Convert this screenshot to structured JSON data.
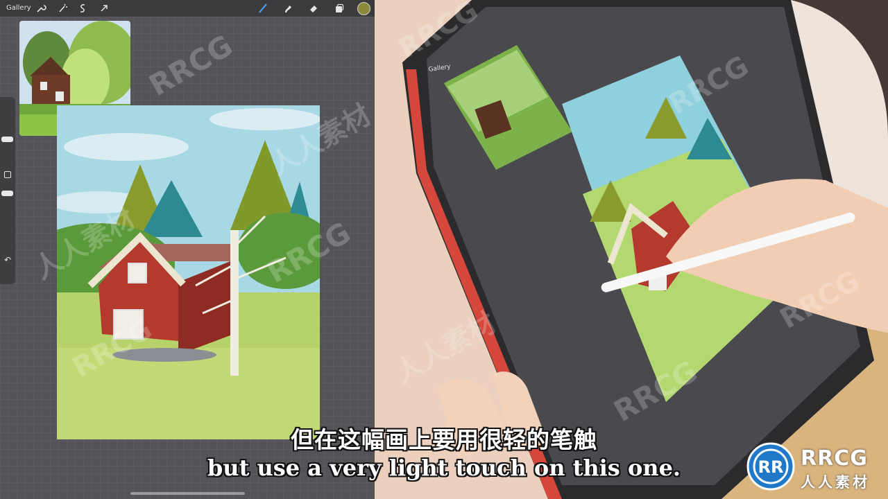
{
  "app": {
    "gallery_label": "Gallery",
    "gallery_label_small": "Gallery",
    "color_swatch": "#8c8a3a"
  },
  "toolbar": {
    "left_icons": [
      "wrench-icon",
      "magic-wand-icon",
      "selection-icon",
      "transform-arrow-icon"
    ],
    "right_icons": [
      "brush-icon",
      "smudge-icon",
      "eraser-icon",
      "layers-icon"
    ]
  },
  "sidebar": {
    "icons": [
      "size-slider",
      "modify-square-icon",
      "opacity-slider",
      "undo-icon"
    ]
  },
  "subtitles": {
    "chinese": "但在这幅画上要用很轻的笔触",
    "english": "but use a very light touch on this one."
  },
  "watermark": {
    "text": "RRCG",
    "cn_text": "人人素材"
  },
  "logo": {
    "primary": "RRCG",
    "secondary": "人人素材"
  }
}
